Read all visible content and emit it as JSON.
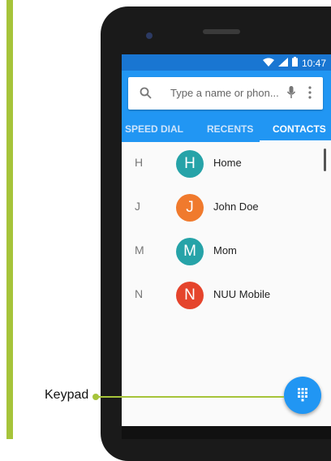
{
  "status": {
    "time": "10:47"
  },
  "search": {
    "placeholder": "Type a name or phon..."
  },
  "tabs": [
    {
      "label": "SPEED DIAL",
      "selected": false
    },
    {
      "label": "RECENTS",
      "selected": false
    },
    {
      "label": "CONTACTS",
      "selected": true
    }
  ],
  "contacts": [
    {
      "letter": "H",
      "initial": "H",
      "name": "Home",
      "color": "#26a3a8"
    },
    {
      "letter": "J",
      "initial": "J",
      "name": "John Doe",
      "color": "#f07a2d"
    },
    {
      "letter": "M",
      "initial": "M",
      "name": "Mom",
      "color": "#26a3a8"
    },
    {
      "letter": "N",
      "initial": "N",
      "name": "NUU Mobile",
      "color": "#e5442c"
    }
  ],
  "callout": {
    "label": "Keypad"
  },
  "colors": {
    "accent": "#2196f3",
    "statusbar": "#1976d2",
    "callout_green": "#a6c43a"
  }
}
